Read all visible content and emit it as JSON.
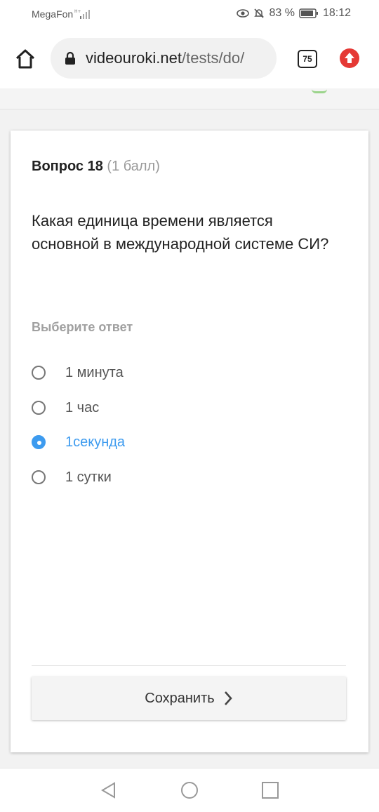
{
  "status_bar": {
    "carrier": "MegaFon",
    "battery_percent": "83 %",
    "time": "18:12",
    "icons": [
      "signal-icon",
      "eye-icon",
      "mute-bell-icon",
      "battery-icon"
    ]
  },
  "browser": {
    "url_domain": "videouroki.net",
    "url_path": "/tests/do/",
    "tab_count": "75",
    "icons": [
      "home-icon",
      "lock-icon",
      "update-arrow-icon"
    ],
    "accent": "#e53935"
  },
  "question": {
    "title": "Вопрос 18",
    "points": "(1 балл)",
    "text": "Какая единица времени является основной в международной системе СИ?",
    "hint": "Выберите ответ",
    "options": [
      {
        "label": "1 минута",
        "selected": false
      },
      {
        "label": "1 час",
        "selected": false
      },
      {
        "label": "1секунда",
        "selected": true
      },
      {
        "label": "1 сутки",
        "selected": false
      }
    ],
    "save_label": "Сохранить",
    "selected_color": "#3d9bef"
  },
  "nav_bar": {
    "icons": [
      "back-triangle-icon",
      "home-circle-icon",
      "recents-square-icon"
    ]
  }
}
